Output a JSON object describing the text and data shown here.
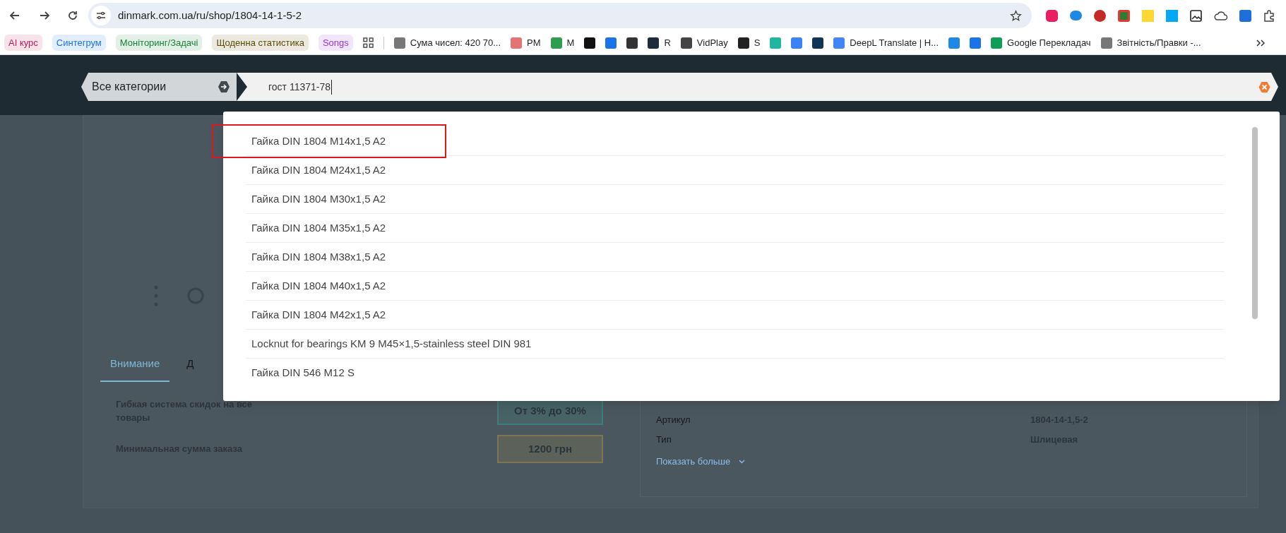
{
  "browser": {
    "url": "dinmark.com.ua/ru/shop/1804-14-1-5-2",
    "bookmarks": [
      {
        "kind": "chip",
        "label": "AI курс",
        "color": "#c2185b"
      },
      {
        "kind": "chip",
        "label": "Синтегрум",
        "color": "#1a73e8"
      },
      {
        "kind": "chip",
        "label": "Моніторинг/Задачі",
        "color": "#188038"
      },
      {
        "kind": "chip",
        "label": "Щоденна статистика",
        "color": "#5f4b00"
      },
      {
        "kind": "chip",
        "label": "Songs",
        "color": "#9334e6"
      },
      {
        "kind": "apps"
      },
      {
        "kind": "link",
        "label": "Сума чисел: 420 70..."
      },
      {
        "kind": "link",
        "label": "PM"
      },
      {
        "kind": "link",
        "label": "M"
      },
      {
        "kind": "icon"
      },
      {
        "kind": "icon"
      },
      {
        "kind": "icon"
      },
      {
        "kind": "link",
        "label": "R"
      },
      {
        "kind": "link",
        "label": "VidPlay"
      },
      {
        "kind": "link",
        "label": "S"
      },
      {
        "kind": "icon"
      },
      {
        "kind": "icon"
      },
      {
        "kind": "icon"
      },
      {
        "kind": "link",
        "label": "DeepL Translate | H..."
      },
      {
        "kind": "icon"
      },
      {
        "kind": "icon"
      },
      {
        "kind": "link",
        "label": "Google Перекладач"
      },
      {
        "kind": "link",
        "label": "Звітність/Правки -..."
      }
    ]
  },
  "search": {
    "category": "Все категории",
    "value": "гост 11371-78"
  },
  "suggestions": [
    {
      "label": "Гайка DIN 1804 M14x1,5 A2",
      "highlighted": true
    },
    {
      "label": "Гайка DIN 1804 M24x1,5 A2",
      "highlighted": false
    },
    {
      "label": "Гайка DIN 1804 M30x1,5 A2",
      "highlighted": false
    },
    {
      "label": "Гайка DIN 1804 M35x1,5 A2",
      "highlighted": false
    },
    {
      "label": "Гайка DIN 1804 M38x1,5 A2",
      "highlighted": false
    },
    {
      "label": "Гайка DIN 1804 M40x1,5 A2",
      "highlighted": false
    },
    {
      "label": "Гайка DIN 1804 M42x1,5 A2",
      "highlighted": false
    },
    {
      "label": "Locknut for bearings KM 9 M45×1,5-stainless steel DIN 981",
      "highlighted": false
    },
    {
      "label": "Гайка DIN 546 M12 S",
      "highlighted": false
    }
  ],
  "product": {
    "tabs": [
      {
        "label": "Внимание",
        "selected": true
      },
      {
        "label": "Д",
        "selected": false
      }
    ],
    "terms": [
      {
        "label": "Гибкая система скидок на все товары",
        "value": "От 3% до 30%",
        "color": "#3f7c7c"
      },
      {
        "label": "Минимальная сумма заказа",
        "value": "1200 грн",
        "color": "#7d7651"
      }
    ],
    "specs": [
      {
        "label": "Артикул",
        "value": "1804-14-1,5-2"
      },
      {
        "label": "Тип",
        "value": "Шлицевая"
      }
    ],
    "more_link": "Показать больше"
  }
}
